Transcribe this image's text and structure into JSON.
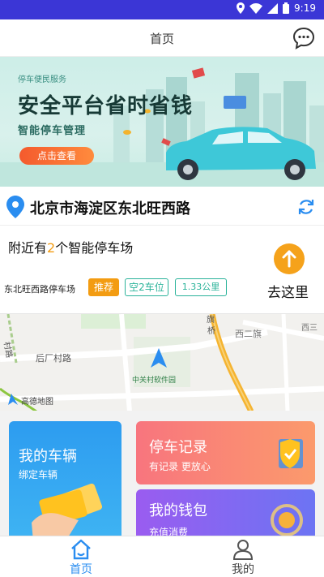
{
  "status_bar": {
    "time": "9:19"
  },
  "header": {
    "title": "首页",
    "message_icon": "chat-bubble-icon"
  },
  "banner": {
    "small_text": "停车便民服务",
    "headline": "安全平台省时省钱",
    "subtitle": "智能停车管理",
    "cta_label": "点击查看"
  },
  "location": {
    "address": "北京市海淀区东北旺西路",
    "pin_icon": "location-pin-icon",
    "refresh_icon": "refresh-icon"
  },
  "nearby": {
    "prefix": "附近有",
    "count": "2",
    "suffix": "个智能停车场",
    "lot_name": "东北旺西路停车场",
    "tag_recommend": "推荐",
    "tag_free": "空2车位",
    "tag_distance": "1.33公里",
    "go_label": "去这里",
    "go_icon": "arrow-up-icon"
  },
  "map": {
    "road_1": "后厂村路",
    "place_1": "中关村软件园",
    "place_2": "西二旗",
    "place_3": "西三",
    "place_4": "旗",
    "place_5": "桥",
    "road_2": "村路",
    "logo_text": "高德地图"
  },
  "cards": {
    "vehicle": {
      "title": "我的车辆",
      "subtitle": "绑定车辆"
    },
    "records": {
      "title": "停车记录",
      "subtitle": "有记录 更放心"
    },
    "wallet": {
      "title": "我的钱包",
      "subtitle": "充值消费"
    }
  },
  "tabbar": {
    "home_label": "首页",
    "me_label": "我的"
  },
  "colors": {
    "status_bar": "#3b36d6",
    "accent": "#2a8df0",
    "orange": "#f39c12",
    "teal": "#2bb39a"
  }
}
